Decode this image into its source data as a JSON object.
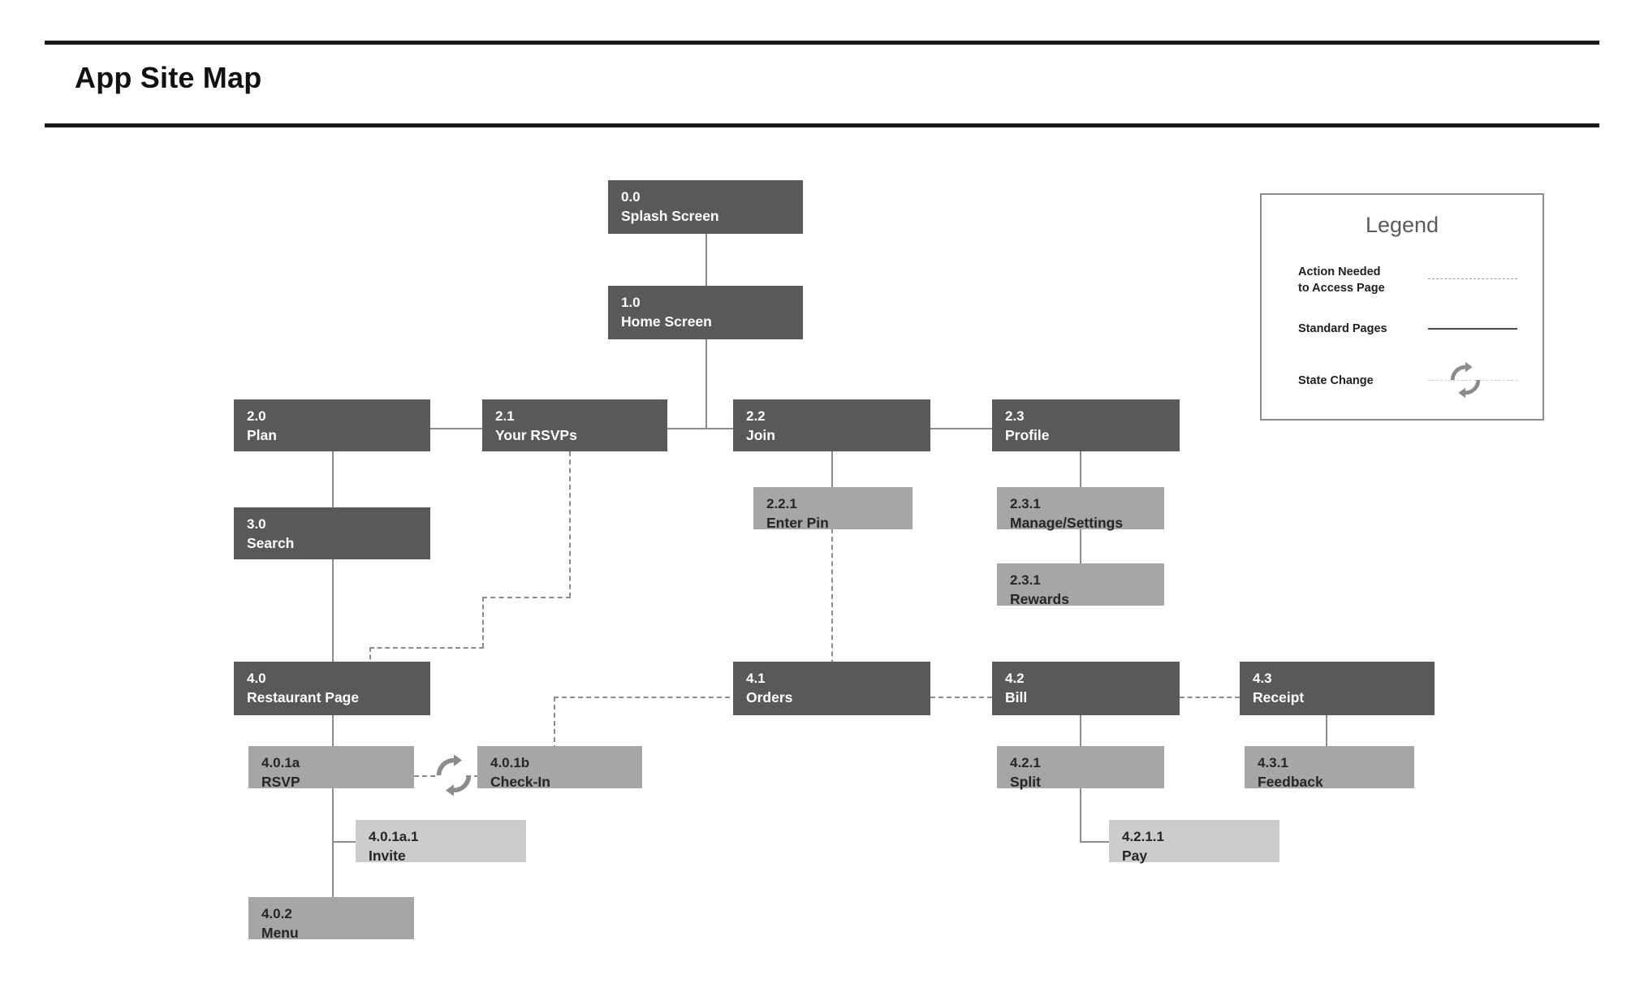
{
  "header": {
    "title": "App Site Map"
  },
  "legend": {
    "title": "Legend",
    "items": [
      {
        "label": "Action Needed\nto Access Page",
        "line": "dashed",
        "icon": "dashed-line-icon"
      },
      {
        "label": "Standard Pages",
        "line": "solid",
        "icon": "solid-line-icon"
      },
      {
        "label": "State Change",
        "line": "state",
        "icon": "state-change-icon"
      }
    ],
    "row_labels": {
      "action_needed_l1": "Action Needed",
      "action_needed_l2": "to Access Page",
      "standard_pages": "Standard Pages",
      "state_change": "State Change"
    }
  },
  "colors": {
    "level0": "#595959",
    "level1": "#a6a6a6",
    "level2": "#cccccc",
    "connector": "#8c8c8c",
    "rule": "#1a1a1a",
    "legend_border": "#8c8c8c",
    "legend_title": "#5a5a5a"
  },
  "nodes": [
    {
      "id": "n0",
      "num": "0.0",
      "label": "Splash Screen",
      "level": 0
    },
    {
      "id": "n1",
      "num": "1.0",
      "label": "Home Screen",
      "level": 0
    },
    {
      "id": "n20",
      "num": "2.0",
      "label": "Plan",
      "level": 0
    },
    {
      "id": "n21",
      "num": "2.1",
      "label": "Your RSVPs",
      "level": 0
    },
    {
      "id": "n22",
      "num": "2.2",
      "label": "Join",
      "level": 0
    },
    {
      "id": "n23",
      "num": "2.3",
      "label": "Profile",
      "level": 0
    },
    {
      "id": "n221",
      "num": "2.2.1",
      "label": "Enter Pin",
      "level": 1
    },
    {
      "id": "n231",
      "num": "2.3.1",
      "label": "Manage/Settings",
      "level": 1
    },
    {
      "id": "n231b",
      "num": "2.3.1",
      "label": "Rewards",
      "level": 1
    },
    {
      "id": "n30",
      "num": "3.0",
      "label": "Search",
      "level": 0
    },
    {
      "id": "n40",
      "num": "4.0",
      "label": "Restaurant Page",
      "level": 0
    },
    {
      "id": "n41",
      "num": "4.1",
      "label": "Orders",
      "level": 0
    },
    {
      "id": "n42",
      "num": "4.2",
      "label": "Bill",
      "level": 0
    },
    {
      "id": "n43",
      "num": "4.3",
      "label": "Receipt",
      "level": 0
    },
    {
      "id": "n401a",
      "num": "4.0.1a",
      "label": "RSVP",
      "level": 1
    },
    {
      "id": "n401b",
      "num": "4.0.1b",
      "label": "Check-In",
      "level": 1
    },
    {
      "id": "n401a1",
      "num": "4.0.1a.1",
      "label": "Invite",
      "level": 2
    },
    {
      "id": "n402",
      "num": "4.0.2",
      "label": "Menu",
      "level": 1
    },
    {
      "id": "n421",
      "num": "4.2.1",
      "label": "Split",
      "level": 1
    },
    {
      "id": "n4211",
      "num": "4.2.1.1",
      "label": "Pay",
      "level": 2
    },
    {
      "id": "n431",
      "num": "4.3.1",
      "label": "Feedback",
      "level": 1
    }
  ]
}
